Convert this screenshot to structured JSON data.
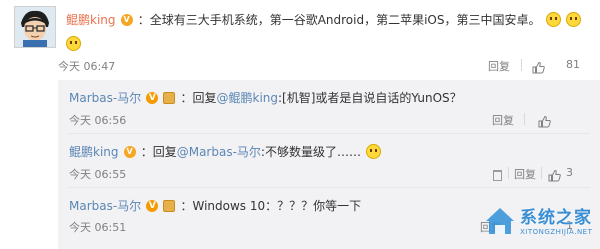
{
  "main_comment": {
    "username": "鲲鹏king",
    "text": "：全球有三大手机系统，第一谷歌Android，第二苹果iOS，第三中国安卓。",
    "time": "今天 06:47",
    "reply_label": "回复",
    "like_count": "81"
  },
  "replies": [
    {
      "username": "Marbas-马尔",
      "reply_prefix": "：回复",
      "mention": "@鲲鹏king",
      "text": ":[机智]或者是自说自话的YunOS？",
      "time": "今天 06:56",
      "reply_label": "回复",
      "like_count": ""
    },
    {
      "username": "鲲鹏king",
      "reply_prefix": "：回复",
      "mention": "@Marbas-马尔",
      "text": ":不够数量级了……",
      "time": "今天 06:55",
      "reply_label": "回复",
      "like_count": "3"
    },
    {
      "username": "Marbas-马尔",
      "reply_prefix": "",
      "mention": "",
      "text": "：Windows 10：？？？你等一下",
      "time": "今天 06:51",
      "reply_label": "回复",
      "like_count": "1"
    }
  ],
  "watermark": {
    "brand": "系统之家",
    "url": "XITONGZHIJIA.NET"
  },
  "colors": {
    "username": "#eb7350",
    "mention": "#5c87b4",
    "reply_bg": "#f2f2f5"
  }
}
